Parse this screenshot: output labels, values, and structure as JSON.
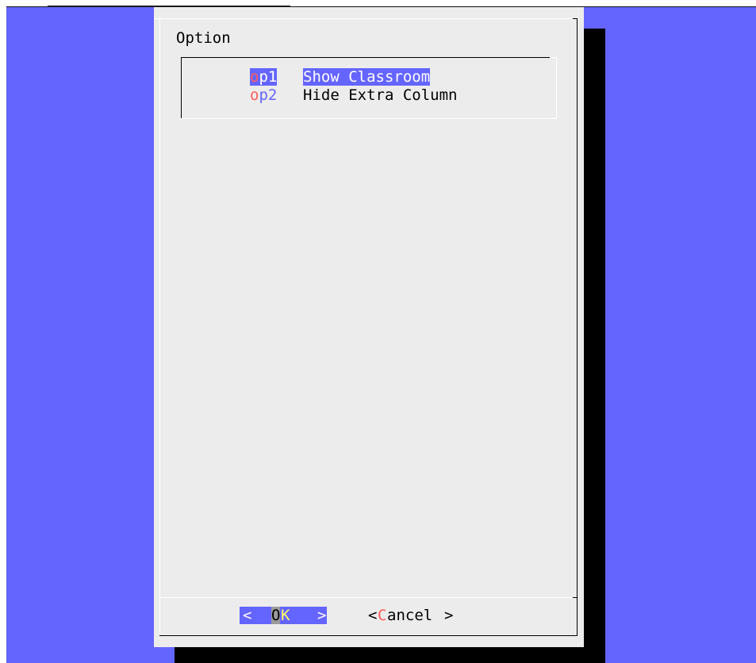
{
  "dialog": {
    "title": "Option",
    "items": [
      {
        "tag_hot": "o",
        "tag_rest": "p1",
        "label": "Show Classroom",
        "selected": true
      },
      {
        "tag_hot": "o",
        "tag_rest": "p2",
        "label": "Hide Extra Column",
        "selected": false
      }
    ],
    "buttons": {
      "ok": {
        "left": "<",
        "hot": "O",
        "rest": "K",
        "right": ">"
      },
      "cancel": {
        "open": "<",
        "hot": "C",
        "rest": "ancel",
        "close": ">"
      }
    }
  },
  "colors": {
    "background": "#6464ff",
    "dialog": "#ececec",
    "shadow": "#000000",
    "hotkey": "#ff5c5c",
    "selection": "#6464ff",
    "ok_focus_k": "#ffff66"
  }
}
